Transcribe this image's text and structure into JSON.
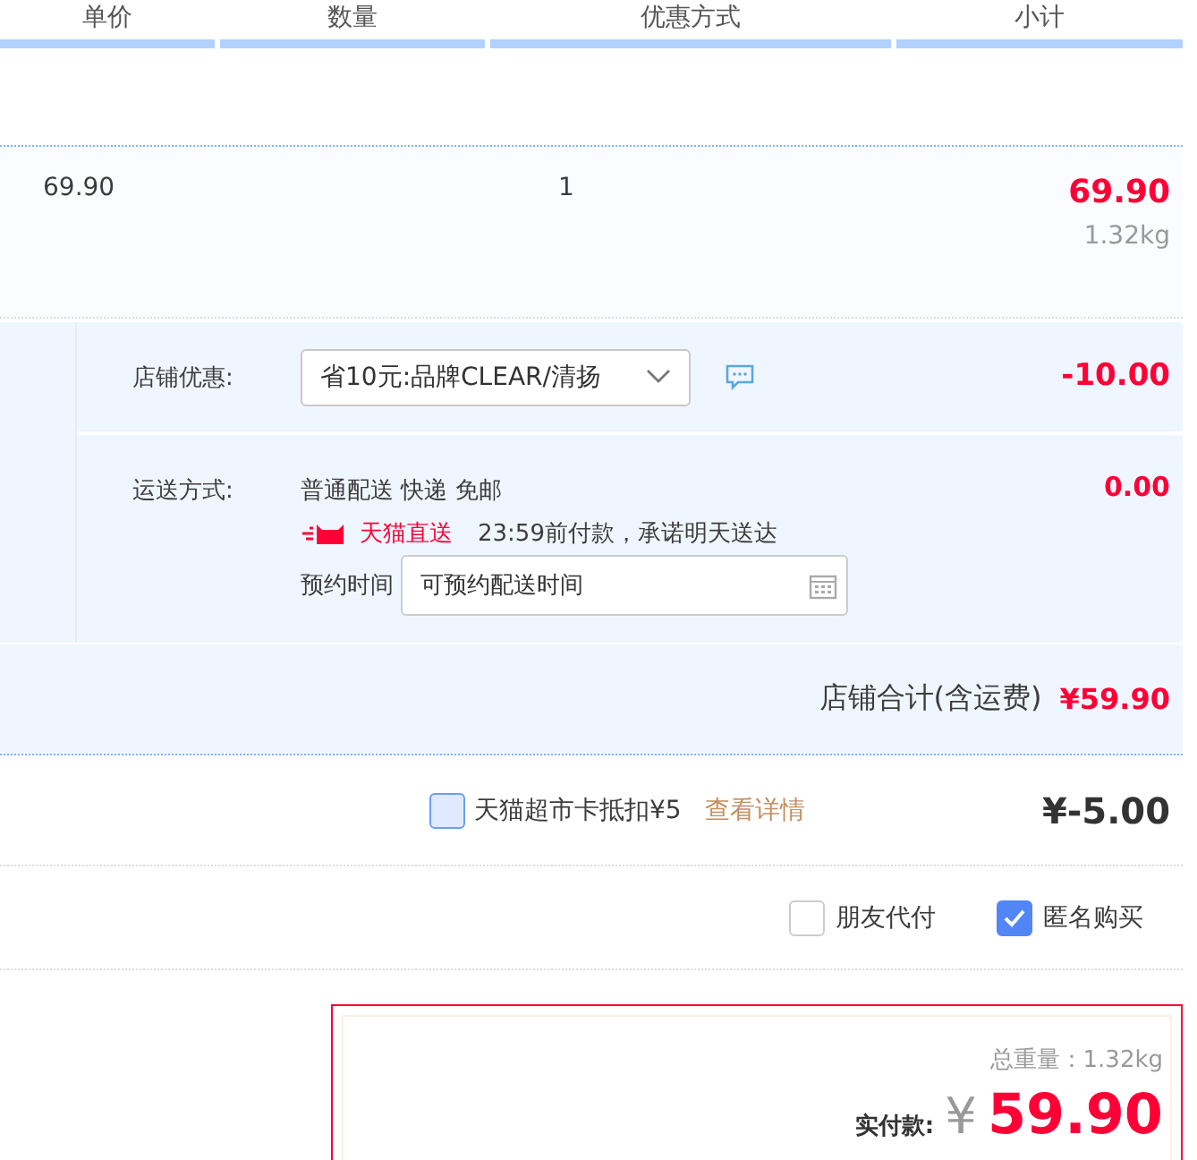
{
  "columns": [
    "单价",
    "数量",
    "优惠方式",
    "小计"
  ],
  "item": {
    "unit_price": "69.90",
    "quantity": "1",
    "subtotal": "69.90",
    "weight": "1.32kg"
  },
  "store_discount": {
    "label": "店铺优惠:",
    "value": "省10元:品牌CLEAR/清扬",
    "amount": "-10.00"
  },
  "shipping": {
    "label": "运送方式:",
    "method": "普通配送 快递 免邮",
    "badge": "天猫直送",
    "promise": "23:59前付款，承诺明天送达",
    "schedule_label": "预约时间",
    "schedule_placeholder": "可预约配送时间",
    "amount": "0.00"
  },
  "store_total": {
    "label": "店铺合计(含运费)",
    "amount": "¥59.90"
  },
  "card": {
    "label": "天猫超市卡抵扣¥5",
    "checked": false,
    "link": "查看详情",
    "amount": "¥-5.00"
  },
  "options": [
    {
      "label": "朋友代付",
      "checked": false
    },
    {
      "label": "匿名购买",
      "checked": true
    }
  ],
  "summary": {
    "weight": "总重量：1.32kg",
    "pay_label": "实付款:",
    "currency": "¥",
    "amount": "59.90"
  }
}
